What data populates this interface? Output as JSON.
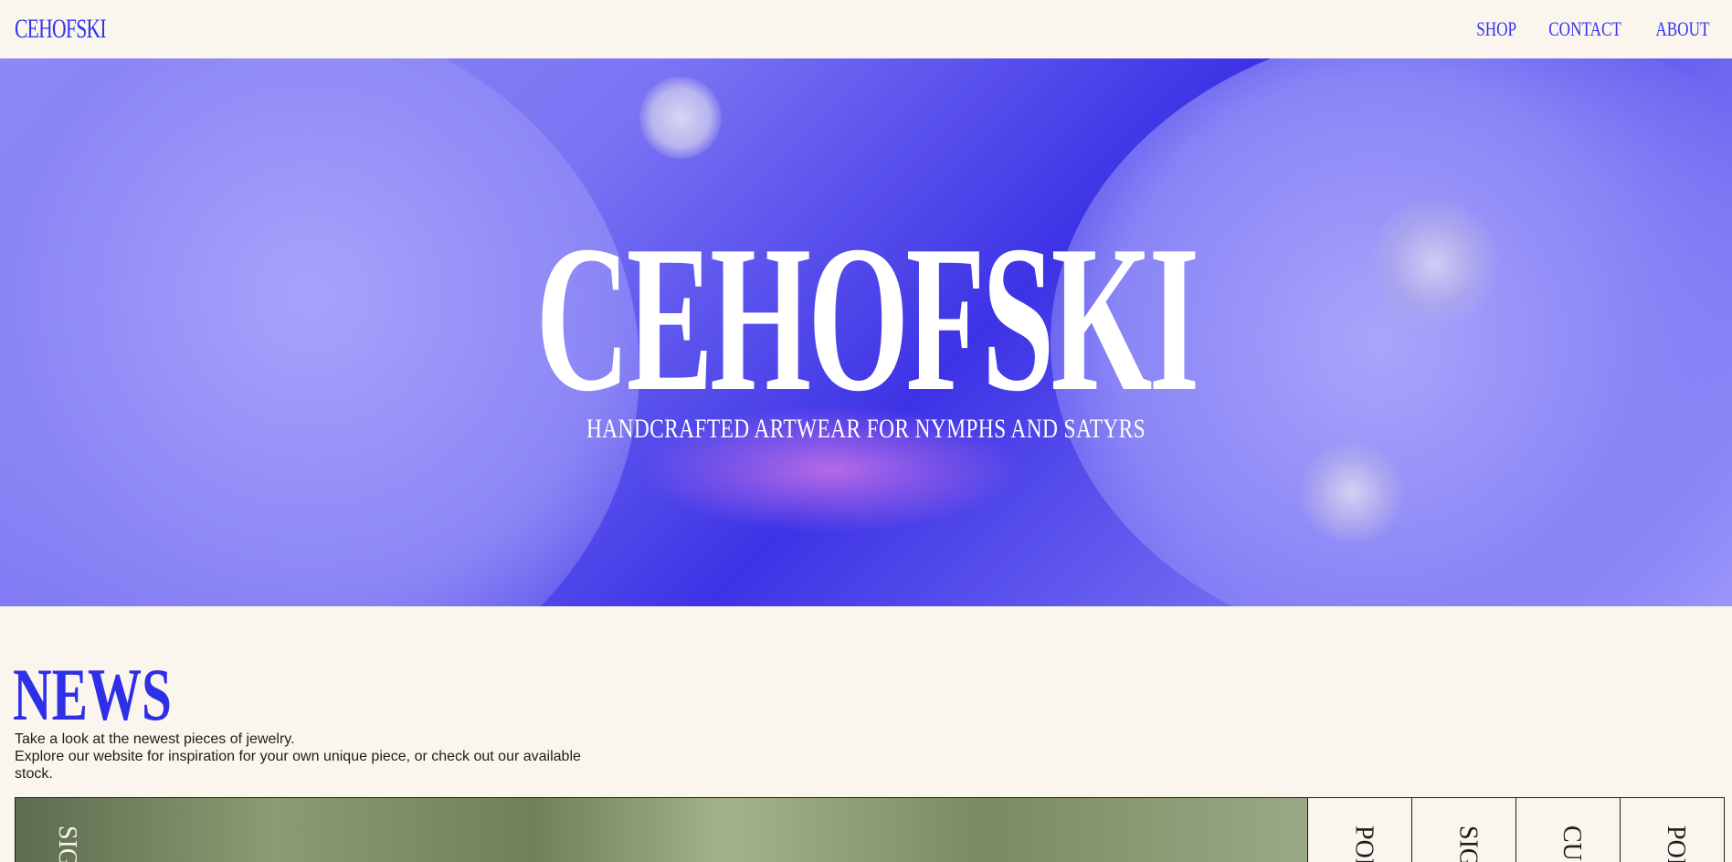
{
  "brand": "CEHOFSKI",
  "nav": [
    "SHOP",
    "CONTACT",
    "ABOUT"
  ],
  "hero": {
    "title": "CEHOFSKI",
    "subtitle": "HANDCRAFTED ARTWEAR FOR NYMPHS AND SATYRS"
  },
  "news": {
    "title": "NEWS",
    "line1": "Take a look at the newest pieces of jewelry.",
    "line2": "Explore our website for inspiration for your own unique piece, or check out our available stock."
  },
  "gallery": {
    "main_label": "SIGI",
    "tabs": [
      "POR",
      "SIGI",
      "CUS",
      "POR"
    ]
  },
  "colors": {
    "accent": "#2f2fe8",
    "background": "#faf6ee",
    "hero_tint": "#4a40ec"
  }
}
